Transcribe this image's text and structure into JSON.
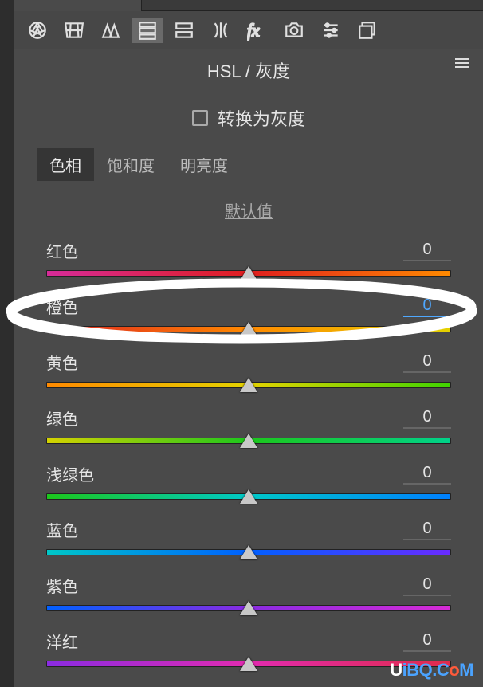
{
  "panel": {
    "title": "HSL / 灰度",
    "grayscale_label": "转换为灰度",
    "grayscale_checked": false,
    "default_link": "默认值"
  },
  "tabs": [
    {
      "label": "色相",
      "active": true
    },
    {
      "label": "饱和度",
      "active": false
    },
    {
      "label": "明亮度",
      "active": false
    }
  ],
  "sliders": {
    "red": {
      "label": "红色",
      "value": "0",
      "gradient": "grad-red"
    },
    "orange": {
      "label": "橙色",
      "value": "0",
      "gradient": "grad-orange",
      "editing": true
    },
    "yellow": {
      "label": "黄色",
      "value": "0",
      "gradient": "grad-yellow"
    },
    "green": {
      "label": "绿色",
      "value": "0",
      "gradient": "grad-green"
    },
    "aqua": {
      "label": "浅绿色",
      "value": "0",
      "gradient": "grad-aqua"
    },
    "blue": {
      "label": "蓝色",
      "value": "0",
      "gradient": "grad-blue"
    },
    "purple": {
      "label": "紫色",
      "value": "0",
      "gradient": "grad-purple"
    },
    "magenta": {
      "label": "洋红",
      "value": "0",
      "gradient": "grad-magenta"
    }
  },
  "watermark": {
    "prefix": "U",
    "mid": "iBQ.C",
    "o": "o",
    "suffix": "M"
  }
}
